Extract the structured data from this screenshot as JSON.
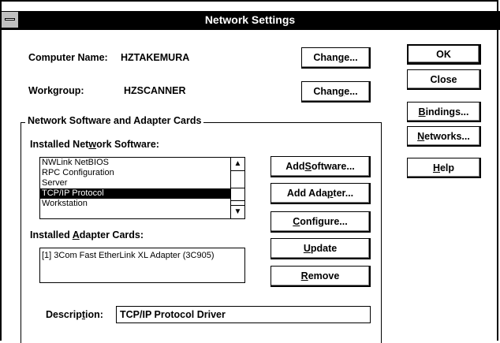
{
  "window": {
    "title": "Network Settings"
  },
  "computer": {
    "label": "Computer Name:",
    "value": "HZTAKEMURA",
    "change_prefix": "Change...",
    "change_label": "Change..."
  },
  "workgroup": {
    "label": "Workgroup:",
    "value": "HZSCANNER",
    "change_pre": "Chan",
    "change_u": "g",
    "change_post": "e..."
  },
  "computer_change": {
    "pre": "Change...",
    "u": "",
    "post": ""
  },
  "group": {
    "title": "Network Software and Adapter Cards"
  },
  "software": {
    "label_pre": "Installed Net",
    "label_u": "w",
    "label_post": "ork Software:",
    "items": [
      {
        "label": "NWLink NetBIOS",
        "selected": false
      },
      {
        "label": "RPC Configuration",
        "selected": false
      },
      {
        "label": "Server",
        "selected": false
      },
      {
        "label": "TCP/IP Protocol",
        "selected": true
      },
      {
        "label": "Workstation",
        "selected": false
      }
    ]
  },
  "adapters": {
    "label_pre": "Installed ",
    "label_u": "A",
    "label_post": "dapter Cards:",
    "items": [
      {
        "label": "[1] 3Com Fast EtherLink XL Adapter (3C905)"
      }
    ]
  },
  "buttons": {
    "add_software": {
      "pre": "Add ",
      "u": "S",
      "post": "oftware..."
    },
    "add_adapter": {
      "pre": "Add Ada",
      "u": "p",
      "post": "ter..."
    },
    "configure": {
      "pre": "",
      "u": "C",
      "post": "onfigure..."
    },
    "update": {
      "pre": "",
      "u": "U",
      "post": "pdate"
    },
    "remove": {
      "pre": "",
      "u": "R",
      "post": "emove"
    },
    "ok": {
      "label": "OK"
    },
    "close": {
      "label": "Close"
    },
    "bindings": {
      "pre": "",
      "u": "B",
      "post": "indings..."
    },
    "networks": {
      "pre": "",
      "u": "N",
      "post": "etworks..."
    },
    "help": {
      "pre": "",
      "u": "H",
      "post": "elp"
    }
  },
  "description": {
    "label_pre": "Descrip",
    "label_u": "t",
    "label_post": "ion:",
    "value": "TCP/IP Protocol Driver"
  },
  "icons": {
    "system_menu": "system-menu-icon",
    "scroll_up": "arrow-up-icon",
    "scroll_down": "arrow-down-icon"
  }
}
